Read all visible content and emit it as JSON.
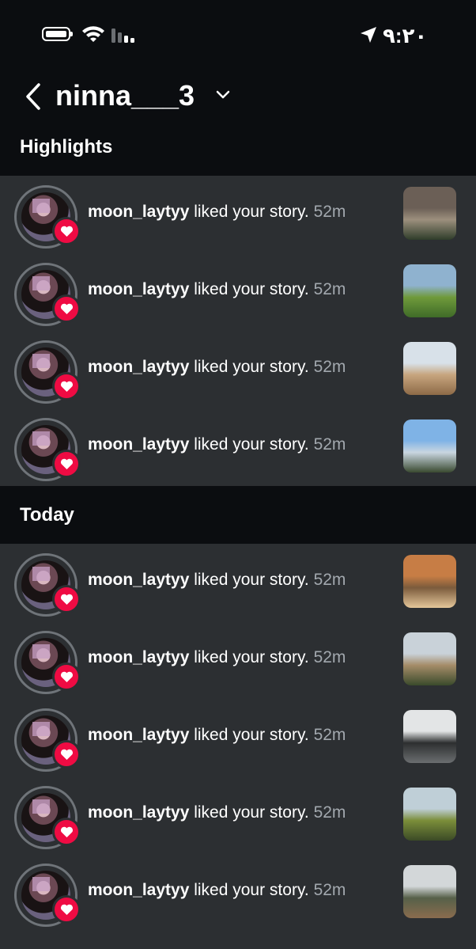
{
  "status_bar": {
    "time": "٩:٢٠",
    "icons": [
      "battery-icon",
      "wifi-icon",
      "signal-icon",
      "location-arrow-icon"
    ]
  },
  "header": {
    "account_name": "ninna___3",
    "icons": [
      "back-arrow-icon",
      "chevron-down-icon"
    ]
  },
  "sections": {
    "highlights_title": "Highlights",
    "today_title": "Today"
  },
  "highlights": [
    {
      "username": "moon_laytyy",
      "message": " liked your story. ",
      "time": "52m",
      "thumb_colors": [
        "#6b5f56",
        "#2f3d2a",
        "#9c8f7d"
      ]
    },
    {
      "username": "moon_laytyy",
      "message": " liked your story. ",
      "time": "52m",
      "thumb_colors": [
        "#8fb2cf",
        "#3f6b28",
        "#6f9a3b"
      ]
    },
    {
      "username": "moon_laytyy",
      "message": " liked your story. ",
      "time": "52m",
      "thumb_colors": [
        "#d8e1e9",
        "#8d6a47",
        "#c7a57e"
      ]
    },
    {
      "username": "moon_laytyy",
      "message": " liked your story. ",
      "time": "52m",
      "thumb_colors": [
        "#7fb3e6",
        "#3a4a30",
        "#c9d6e0"
      ]
    }
  ],
  "today": [
    {
      "username": "moon_laytyy",
      "message": " liked your story. ",
      "time": "52m",
      "thumb_colors": [
        "#c77d45",
        "#e4c69a",
        "#7b5b3c"
      ]
    },
    {
      "username": "moon_laytyy",
      "message": " liked your story. ",
      "time": "52m",
      "thumb_colors": [
        "#c9d2d9",
        "#3a4a2b",
        "#a58c68"
      ]
    },
    {
      "username": "moon_laytyy",
      "message": " liked your story. ",
      "time": "52m",
      "thumb_colors": [
        "#e3e5e6",
        "#6b6e70",
        "#2d2f30"
      ]
    },
    {
      "username": "moon_laytyy",
      "message": " liked your story. ",
      "time": "52m",
      "thumb_colors": [
        "#bfcfd7",
        "#3b4a26",
        "#7b8e3a"
      ]
    },
    {
      "username": "moon_laytyy",
      "message": " liked your story. ",
      "time": "52m",
      "thumb_colors": [
        "#d3d7d9",
        "#8a6c4e",
        "#566049"
      ]
    }
  ],
  "colors": {
    "background": "#0b0d10",
    "list_background": "#2c2f32",
    "heart": "#ef0b43",
    "time_text": "#a2a8ae"
  }
}
